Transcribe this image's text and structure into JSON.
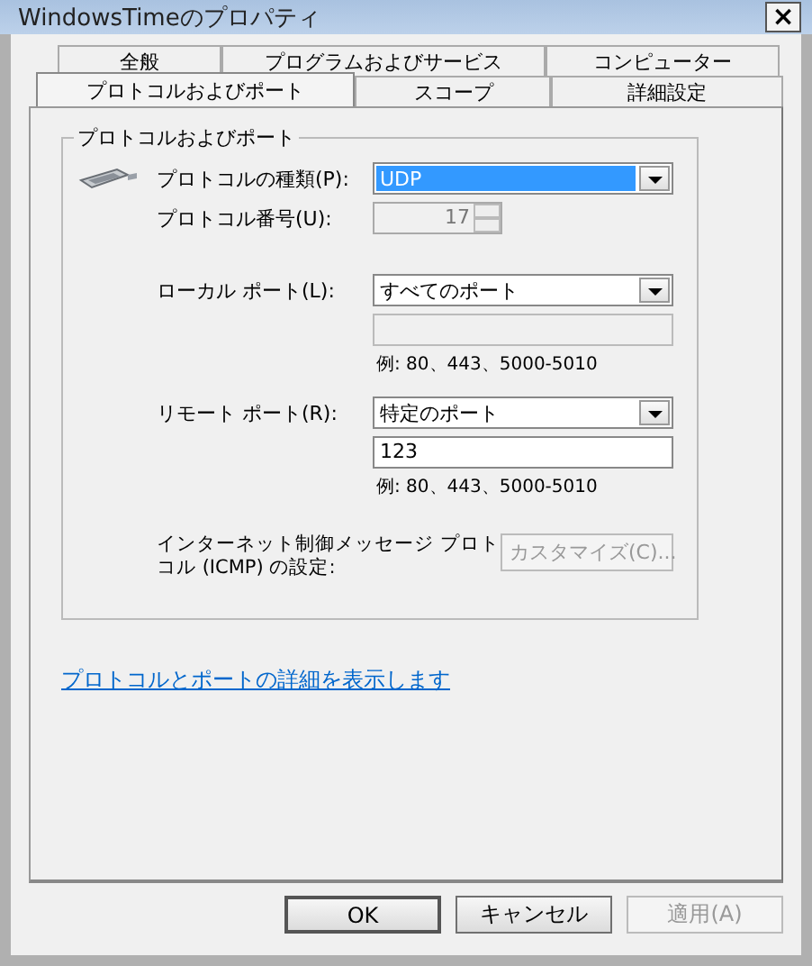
{
  "window": {
    "title": "WindowsTimeのプロパティ",
    "close": "×"
  },
  "tab_rows": [
    [
      {
        "label": "全般",
        "selected": false
      },
      {
        "label": "プログラムおよびサービス",
        "selected": false
      },
      {
        "label": "コンピューター",
        "selected": false
      }
    ],
    [
      {
        "label": "プロトコルおよびポート",
        "selected": true
      },
      {
        "label": "スコープ",
        "selected": false
      },
      {
        "label": "詳細設定",
        "selected": false
      }
    ]
  ],
  "group": {
    "title": "プロトコルおよびポート",
    "protocol_type": {
      "label": "プロトコルの種類(P):",
      "value": "UDP"
    },
    "protocol_number": {
      "label": "プロトコル番号(U):",
      "value": "17",
      "disabled": true
    },
    "local_port": {
      "label": "ローカル ポート(L):",
      "value": "すべてのポート",
      "field_disabled": true,
      "example": "例: 80、443、5000-5010"
    },
    "remote_port": {
      "label": "リモート ポート(R):",
      "value": "特定のポート",
      "field_value": "123",
      "field_disabled": false,
      "example": "例: 80、443、5000-5010"
    },
    "icmp": {
      "label": "インターネット制御メッセージ プロトコル (ICMP) の設定:",
      "button": "カスタマイズ(C)...",
      "disabled": true
    }
  },
  "link": "プロトコルとポートの詳細を表示します",
  "buttons": [
    {
      "label": "OK",
      "disabled": false,
      "default": true
    },
    {
      "label": "キャンセル",
      "disabled": false,
      "default": false
    },
    {
      "label": "適用(A)",
      "disabled": true,
      "default": false
    }
  ]
}
